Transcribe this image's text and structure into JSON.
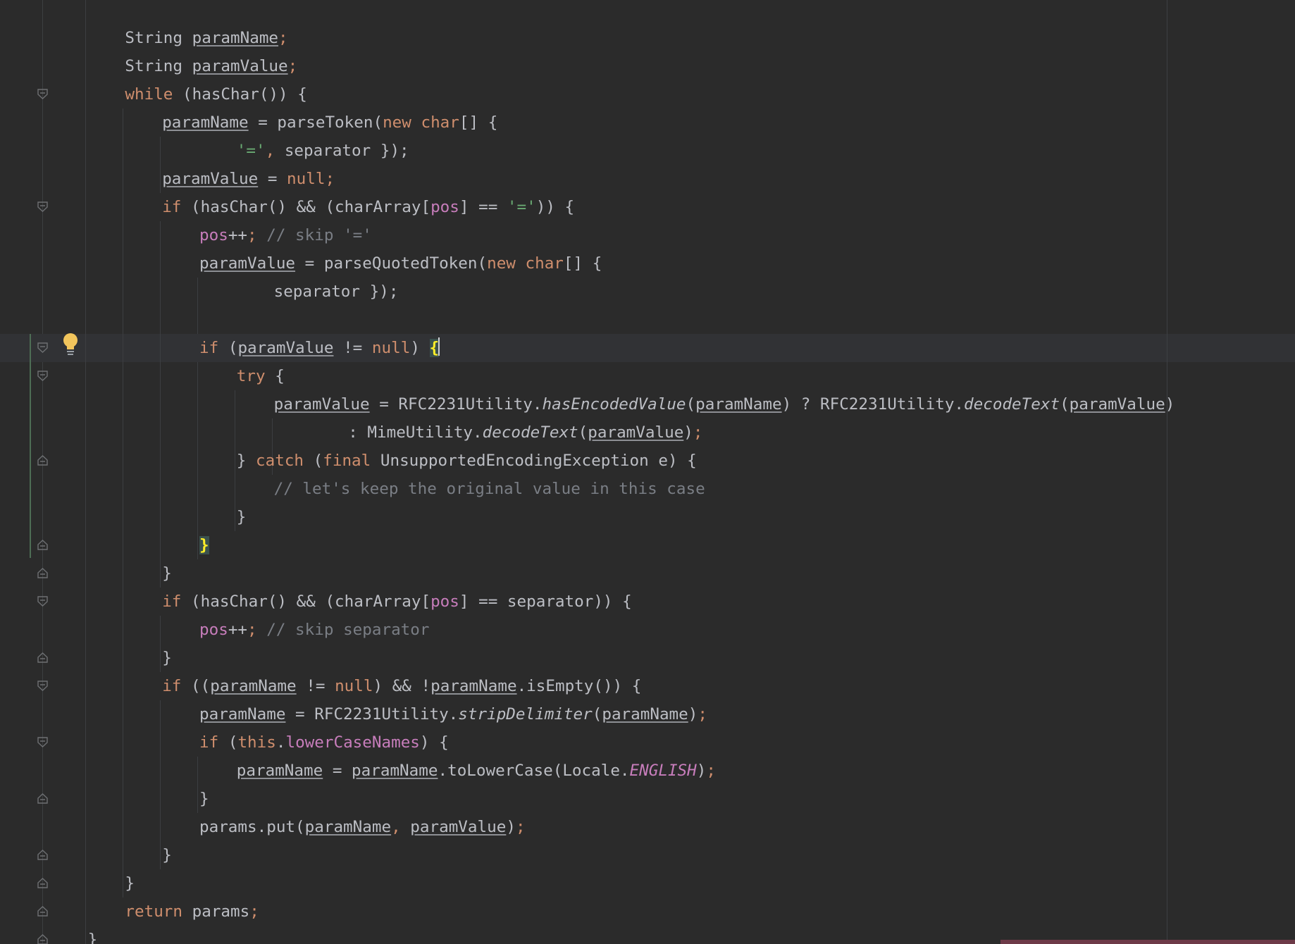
{
  "editor": {
    "language": "java",
    "lines": [
      {
        "indent": 3,
        "spans": [
          {
            "t": "String ",
            "c": "plain"
          },
          {
            "t": "paramName",
            "c": "var"
          },
          {
            "t": ";",
            "c": "kw"
          }
        ]
      },
      {
        "indent": 3,
        "spans": [
          {
            "t": "String ",
            "c": "plain"
          },
          {
            "t": "paramValue",
            "c": "var"
          },
          {
            "t": ";",
            "c": "kw"
          }
        ]
      },
      {
        "indent": 3,
        "spans": [
          {
            "t": "while",
            "c": "kw"
          },
          {
            "t": " (hasChar()) {",
            "c": "plain"
          }
        ]
      },
      {
        "indent": 4,
        "spans": [
          {
            "t": "paramName",
            "c": "var"
          },
          {
            "t": " = parseToken(",
            "c": "plain"
          },
          {
            "t": "new char",
            "c": "kw"
          },
          {
            "t": "[] {",
            "c": "plain"
          }
        ]
      },
      {
        "indent": 6,
        "spans": [
          {
            "t": "'='",
            "c": "str"
          },
          {
            "t": ",",
            "c": "kw"
          },
          {
            "t": " separator });",
            "c": "plain"
          }
        ]
      },
      {
        "indent": 4,
        "spans": [
          {
            "t": "paramValue",
            "c": "var"
          },
          {
            "t": " = ",
            "c": "plain"
          },
          {
            "t": "null;",
            "c": "kw"
          }
        ]
      },
      {
        "indent": 4,
        "spans": [
          {
            "t": "if",
            "c": "kw"
          },
          {
            "t": " (hasChar() && (charArray[",
            "c": "plain"
          },
          {
            "t": "pos",
            "c": "fld"
          },
          {
            "t": "] == ",
            "c": "plain"
          },
          {
            "t": "'='",
            "c": "str"
          },
          {
            "t": ")) {",
            "c": "plain"
          }
        ]
      },
      {
        "indent": 5,
        "spans": [
          {
            "t": "pos",
            "c": "fld"
          },
          {
            "t": "++",
            "c": "plain"
          },
          {
            "t": ";",
            "c": "kw"
          },
          {
            "t": " // skip '='",
            "c": "cmt"
          }
        ]
      },
      {
        "indent": 5,
        "spans": [
          {
            "t": "paramValue",
            "c": "var"
          },
          {
            "t": " = parseQuotedToken(",
            "c": "plain"
          },
          {
            "t": "new char",
            "c": "kw"
          },
          {
            "t": "[] {",
            "c": "plain"
          }
        ]
      },
      {
        "indent": 7,
        "spans": [
          {
            "t": "separator });",
            "c": "plain"
          }
        ]
      },
      {
        "indent": 0,
        "spans": []
      },
      {
        "indent": 5,
        "spans": [
          {
            "t": "if",
            "c": "kw"
          },
          {
            "t": " (",
            "c": "plain"
          },
          {
            "t": "paramValue",
            "c": "var"
          },
          {
            "t": " != ",
            "c": "plain"
          },
          {
            "t": "null",
            "c": "kw"
          },
          {
            "t": ") ",
            "c": "plain"
          },
          {
            "t": "{",
            "c": "brace"
          },
          {
            "t": "",
            "c": "caret"
          }
        ]
      },
      {
        "indent": 6,
        "spans": [
          {
            "t": "try",
            "c": "kw"
          },
          {
            "t": " {",
            "c": "plain"
          }
        ]
      },
      {
        "indent": 7,
        "spans": [
          {
            "t": "paramValue",
            "c": "var"
          },
          {
            "t": " = RFC2231Utility.",
            "c": "plain"
          },
          {
            "t": "hasEncodedValue",
            "c": "italic"
          },
          {
            "t": "(",
            "c": "plain"
          },
          {
            "t": "paramName",
            "c": "var"
          },
          {
            "t": ") ? RFC2231Utility.",
            "c": "plain"
          },
          {
            "t": "decodeText",
            "c": "italic"
          },
          {
            "t": "(",
            "c": "plain"
          },
          {
            "t": "paramValue",
            "c": "var"
          },
          {
            "t": ")",
            "c": "plain"
          }
        ]
      },
      {
        "indent": 9,
        "spans": [
          {
            "t": ": MimeUtility.",
            "c": "plain"
          },
          {
            "t": "decodeText",
            "c": "italic"
          },
          {
            "t": "(",
            "c": "plain"
          },
          {
            "t": "paramValue",
            "c": "var"
          },
          {
            "t": ")",
            "c": "plain"
          },
          {
            "t": ";",
            "c": "kw"
          }
        ]
      },
      {
        "indent": 6,
        "spans": [
          {
            "t": "} ",
            "c": "plain"
          },
          {
            "t": "catch",
            "c": "kw"
          },
          {
            "t": " (",
            "c": "plain"
          },
          {
            "t": "final",
            "c": "kw"
          },
          {
            "t": " UnsupportedEncodingException e) {",
            "c": "plain"
          }
        ]
      },
      {
        "indent": 7,
        "spans": [
          {
            "t": "// let's keep the original value in this case",
            "c": "cmt"
          }
        ]
      },
      {
        "indent": 6,
        "spans": [
          {
            "t": "}",
            "c": "plain"
          }
        ]
      },
      {
        "indent": 5,
        "spans": [
          {
            "t": "}",
            "c": "brace"
          }
        ]
      },
      {
        "indent": 4,
        "spans": [
          {
            "t": "}",
            "c": "plain"
          }
        ]
      },
      {
        "indent": 4,
        "spans": [
          {
            "t": "if",
            "c": "kw"
          },
          {
            "t": " (hasChar() && (charArray[",
            "c": "plain"
          },
          {
            "t": "pos",
            "c": "fld"
          },
          {
            "t": "] == separator)) {",
            "c": "plain"
          }
        ]
      },
      {
        "indent": 5,
        "spans": [
          {
            "t": "pos",
            "c": "fld"
          },
          {
            "t": "++",
            "c": "plain"
          },
          {
            "t": ";",
            "c": "kw"
          },
          {
            "t": " // skip separator",
            "c": "cmt"
          }
        ]
      },
      {
        "indent": 4,
        "spans": [
          {
            "t": "}",
            "c": "plain"
          }
        ]
      },
      {
        "indent": 4,
        "spans": [
          {
            "t": "if",
            "c": "kw"
          },
          {
            "t": " ((",
            "c": "plain"
          },
          {
            "t": "paramName",
            "c": "var"
          },
          {
            "t": " != ",
            "c": "plain"
          },
          {
            "t": "null",
            "c": "kw"
          },
          {
            "t": ") && !",
            "c": "plain"
          },
          {
            "t": "paramName",
            "c": "var"
          },
          {
            "t": ".isEmpty()) {",
            "c": "plain"
          }
        ]
      },
      {
        "indent": 5,
        "spans": [
          {
            "t": "paramName",
            "c": "var"
          },
          {
            "t": " = RFC2231Utility.",
            "c": "plain"
          },
          {
            "t": "stripDelimiter",
            "c": "italic"
          },
          {
            "t": "(",
            "c": "plain"
          },
          {
            "t": "paramName",
            "c": "var"
          },
          {
            "t": ")",
            "c": "plain"
          },
          {
            "t": ";",
            "c": "kw"
          }
        ]
      },
      {
        "indent": 5,
        "spans": [
          {
            "t": "if",
            "c": "kw"
          },
          {
            "t": " (",
            "c": "plain"
          },
          {
            "t": "this",
            "c": "kw"
          },
          {
            "t": ".",
            "c": "plain"
          },
          {
            "t": "lowerCaseNames",
            "c": "fld"
          },
          {
            "t": ") {",
            "c": "plain"
          }
        ]
      },
      {
        "indent": 6,
        "spans": [
          {
            "t": "paramName",
            "c": "var"
          },
          {
            "t": " = ",
            "c": "plain"
          },
          {
            "t": "paramName",
            "c": "var"
          },
          {
            "t": ".toLowerCase(Locale.",
            "c": "plain"
          },
          {
            "t": "ENGLISH",
            "c": "static"
          },
          {
            "t": ")",
            "c": "plain"
          },
          {
            "t": ";",
            "c": "kw"
          }
        ]
      },
      {
        "indent": 5,
        "spans": [
          {
            "t": "}",
            "c": "plain"
          }
        ]
      },
      {
        "indent": 5,
        "spans": [
          {
            "t": "params.put(",
            "c": "plain"
          },
          {
            "t": "paramName",
            "c": "var"
          },
          {
            "t": ", ",
            "c": "kw"
          },
          {
            "t": "paramValue",
            "c": "var"
          },
          {
            "t": ")",
            "c": "plain"
          },
          {
            "t": ";",
            "c": "kw"
          }
        ]
      },
      {
        "indent": 4,
        "spans": [
          {
            "t": "}",
            "c": "plain"
          }
        ]
      },
      {
        "indent": 3,
        "spans": [
          {
            "t": "}",
            "c": "plain"
          }
        ]
      },
      {
        "indent": 3,
        "spans": [
          {
            "t": "return",
            "c": "kw"
          },
          {
            "t": " params",
            "c": "plain"
          },
          {
            "t": ";",
            "c": "kw"
          }
        ]
      },
      {
        "indent": 2,
        "spans": [
          {
            "t": "}",
            "c": "plain"
          }
        ]
      }
    ]
  },
  "colors": {
    "background": "#2b2b2b",
    "text": "#bcbec4",
    "keyword": "#cf8e6d",
    "string": "#6aab73",
    "field": "#c77dbb",
    "comment": "#7a7e85",
    "brace_match_bg": "#3b514d",
    "brace_match_fg": "#ffef28",
    "bulb": "#f2c55c"
  },
  "gutter": {
    "intention_icon": "lightbulb-icon",
    "fold_markers": "fold-marker-icon"
  }
}
